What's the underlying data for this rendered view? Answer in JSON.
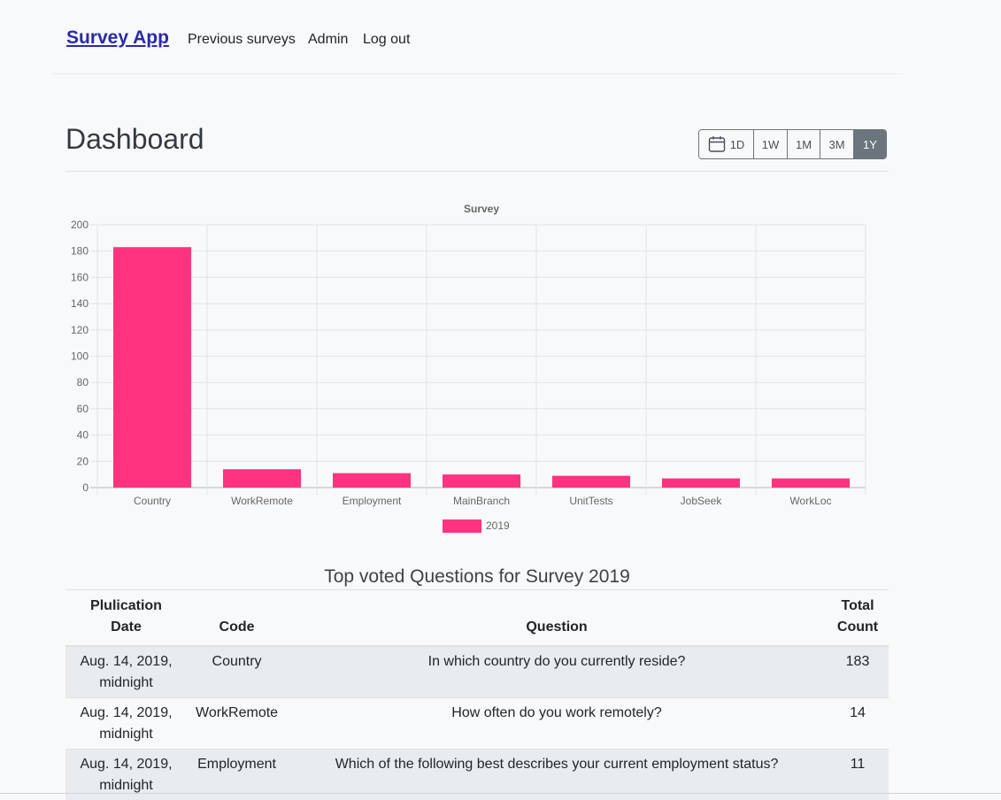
{
  "nav": {
    "brand": "Survey App",
    "links": [
      "Previous surveys",
      "Admin",
      "Log out"
    ]
  },
  "header": {
    "title": "Dashboard",
    "ranges": [
      "1D",
      "1W",
      "1M",
      "3M",
      "1Y"
    ],
    "active_range": "1Y",
    "calendar_icon": "calendar-icon"
  },
  "chart_data": {
    "type": "bar",
    "title": "Survey",
    "categories": [
      "Country",
      "WorkRemote",
      "Employment",
      "MainBranch",
      "UnitTests",
      "JobSeek",
      "WorkLoc"
    ],
    "series": [
      {
        "name": "2019",
        "values": [
          183,
          14,
          11,
          10,
          9,
          7,
          7
        ],
        "color": "#ff3380"
      }
    ],
    "ylim": [
      0,
      200
    ],
    "yticks": [
      0,
      20,
      40,
      60,
      80,
      100,
      120,
      140,
      160,
      180,
      200
    ],
    "grid": true,
    "legend": "bottom"
  },
  "table": {
    "title": "Top voted Questions for Survey 2019",
    "headers": [
      "Plulication Date",
      "Code",
      "Question",
      "Total Count"
    ],
    "rows": [
      [
        "Aug. 14, 2019, midnight",
        "Country",
        "In which country do you currently reside?",
        "183"
      ],
      [
        "Aug. 14, 2019, midnight",
        "WorkRemote",
        "How often do you work remotely?",
        "14"
      ],
      [
        "Aug. 14, 2019, midnight",
        "Employment",
        "Which of the following best describes your current employment status?",
        "11"
      ]
    ]
  }
}
